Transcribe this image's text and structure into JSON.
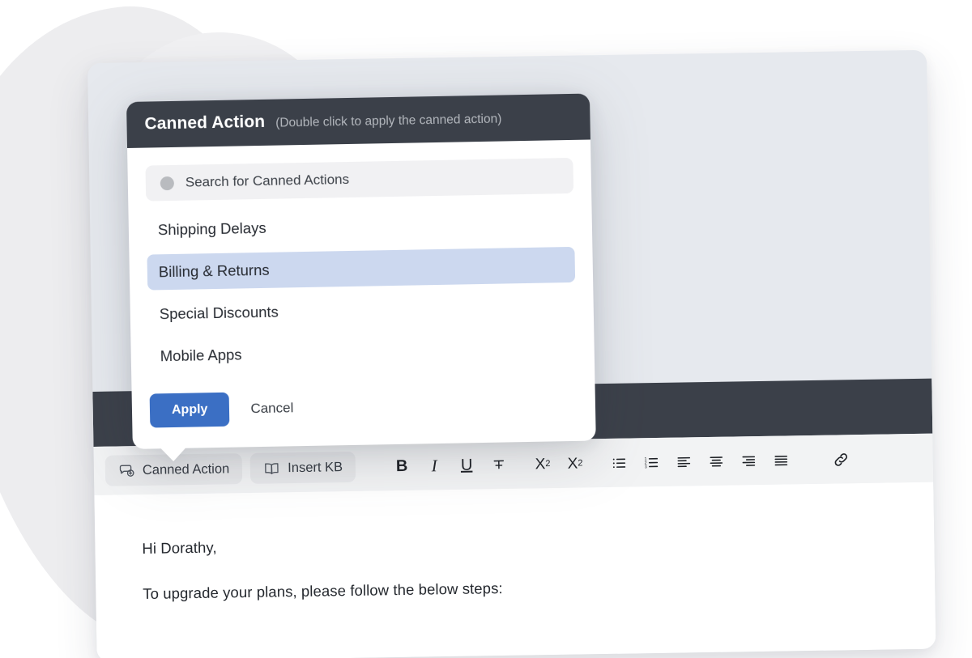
{
  "popup": {
    "title": "Canned Action",
    "hint": "(Double click to apply the canned action)",
    "search": {
      "placeholder": "Search for Canned Actions",
      "icon": "search-icon"
    },
    "items": [
      {
        "label": "Shipping Delays",
        "selected": false
      },
      {
        "label": "Billing & Returns",
        "selected": true
      },
      {
        "label": "Special Discounts",
        "selected": false
      },
      {
        "label": "Mobile Apps",
        "selected": false
      }
    ],
    "apply_label": "Apply",
    "cancel_label": "Cancel"
  },
  "toolbar": {
    "canned_action_label": "Canned Action",
    "canned_action_icon": "speech-bubble-plus-icon",
    "insert_kb_label": "Insert KB",
    "insert_kb_icon": "open-book-icon",
    "bold_label": "B",
    "italic_label": "I",
    "underline_label": "U",
    "strikethrough_icon": "strikethrough-icon",
    "subscript_label": "X",
    "subscript_index": "2",
    "superscript_label": "X",
    "superscript_index": "2",
    "bullet_list_icon": "bullet-list-icon",
    "numbered_list_icon": "numbered-list-icon",
    "align_left_icon": "align-left-icon",
    "align_center_icon": "align-center-icon",
    "align_right_icon": "align-right-icon",
    "align_justify_icon": "align-justify-icon",
    "link_icon": "link-icon"
  },
  "message": {
    "greeting": "Hi Dorathy,",
    "line_1": "To upgrade your plans, please follow the below steps:"
  },
  "colors": {
    "accent_blue": "#3b6fc4",
    "selection_blue": "#ccd8ef",
    "header_dark": "#3b4049",
    "card_surface": "#e6e9ee",
    "toolbar_bg": "#f2f3f4"
  }
}
